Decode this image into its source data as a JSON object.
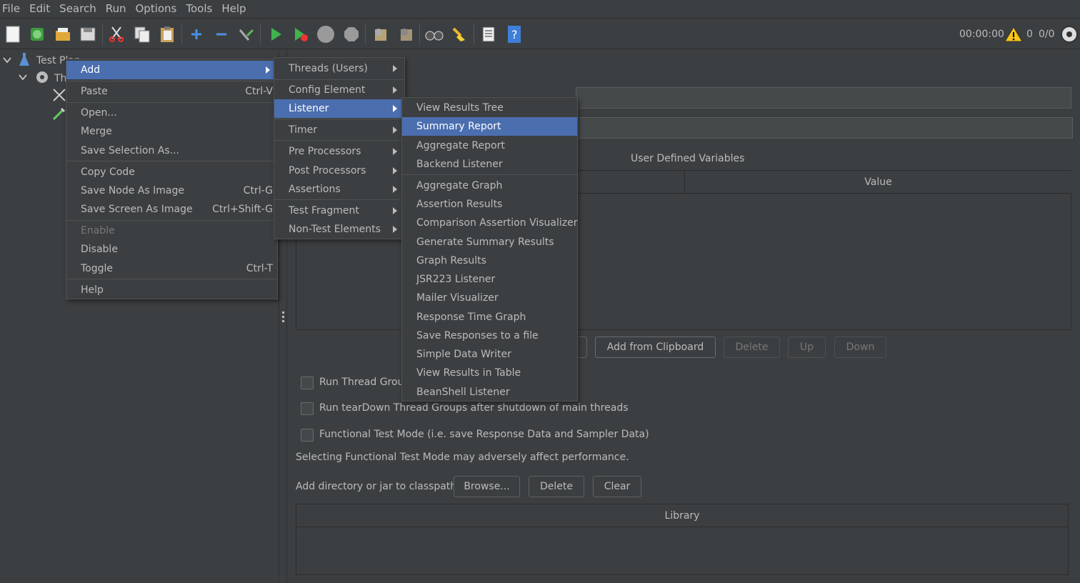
{
  "menubar": [
    "File",
    "Edit",
    "Search",
    "Run",
    "Options",
    "Tools",
    "Help"
  ],
  "toolbar": {
    "timer": "00:00:00",
    "warnings": "0",
    "threads": "0/0"
  },
  "tree": {
    "root": "Test Plan",
    "child": "Th"
  },
  "context_menu": {
    "add": "Add",
    "paste": "Paste",
    "paste_key": "Ctrl-V",
    "open": "Open...",
    "merge": "Merge",
    "save_selection": "Save Selection As...",
    "copy_code": "Copy Code",
    "save_node_image": "Save Node As Image",
    "save_node_key": "Ctrl-G",
    "save_screen_image": "Save Screen As Image",
    "save_screen_key": "Ctrl+Shift-G",
    "enable": "Enable",
    "disable": "Disable",
    "toggle": "Toggle",
    "toggle_key": "Ctrl-T",
    "help": "Help"
  },
  "add_menu": [
    "Threads (Users)",
    "Config Element",
    "Listener",
    "Timer",
    "Pre Processors",
    "Post Processors",
    "Assertions",
    "Test Fragment",
    "Non-Test Elements"
  ],
  "listener_menu": [
    "View Results Tree",
    "Summary Report",
    "Aggregate Report",
    "Backend Listener",
    "Aggregate Graph",
    "Assertion Results",
    "Comparison Assertion Visualizer",
    "Generate Summary Results",
    "Graph Results",
    "JSR223 Listener",
    "Mailer Visualizer",
    "Response Time Graph",
    "Save Responses to a file",
    "Simple Data Writer",
    "View Results in Table",
    "BeanShell Listener"
  ],
  "panel": {
    "udv_title": "User Defined Variables",
    "col_value": "Value",
    "btn_add_clipboard": "Add from Clipboard",
    "btn_delete": "Delete",
    "btn_up": "Up",
    "btn_down": "Down",
    "chk_run_groups": "Run Thread Group",
    "chk_teardown": "Run tearDown Thread Groups after shutdown of main threads",
    "chk_functional": "Functional Test Mode (i.e. save Response Data and Sampler Data)",
    "functional_note": "Selecting Functional Test Mode may adversely affect performance.",
    "classpath_label": "Add directory or jar to classpath",
    "btn_browse": "Browse...",
    "btn_cp_delete": "Delete",
    "btn_clear": "Clear",
    "col_library": "Library"
  },
  "colors": {
    "bg": "#3c3f41",
    "selection": "#4b6eaf",
    "text": "#bbbbbb"
  }
}
